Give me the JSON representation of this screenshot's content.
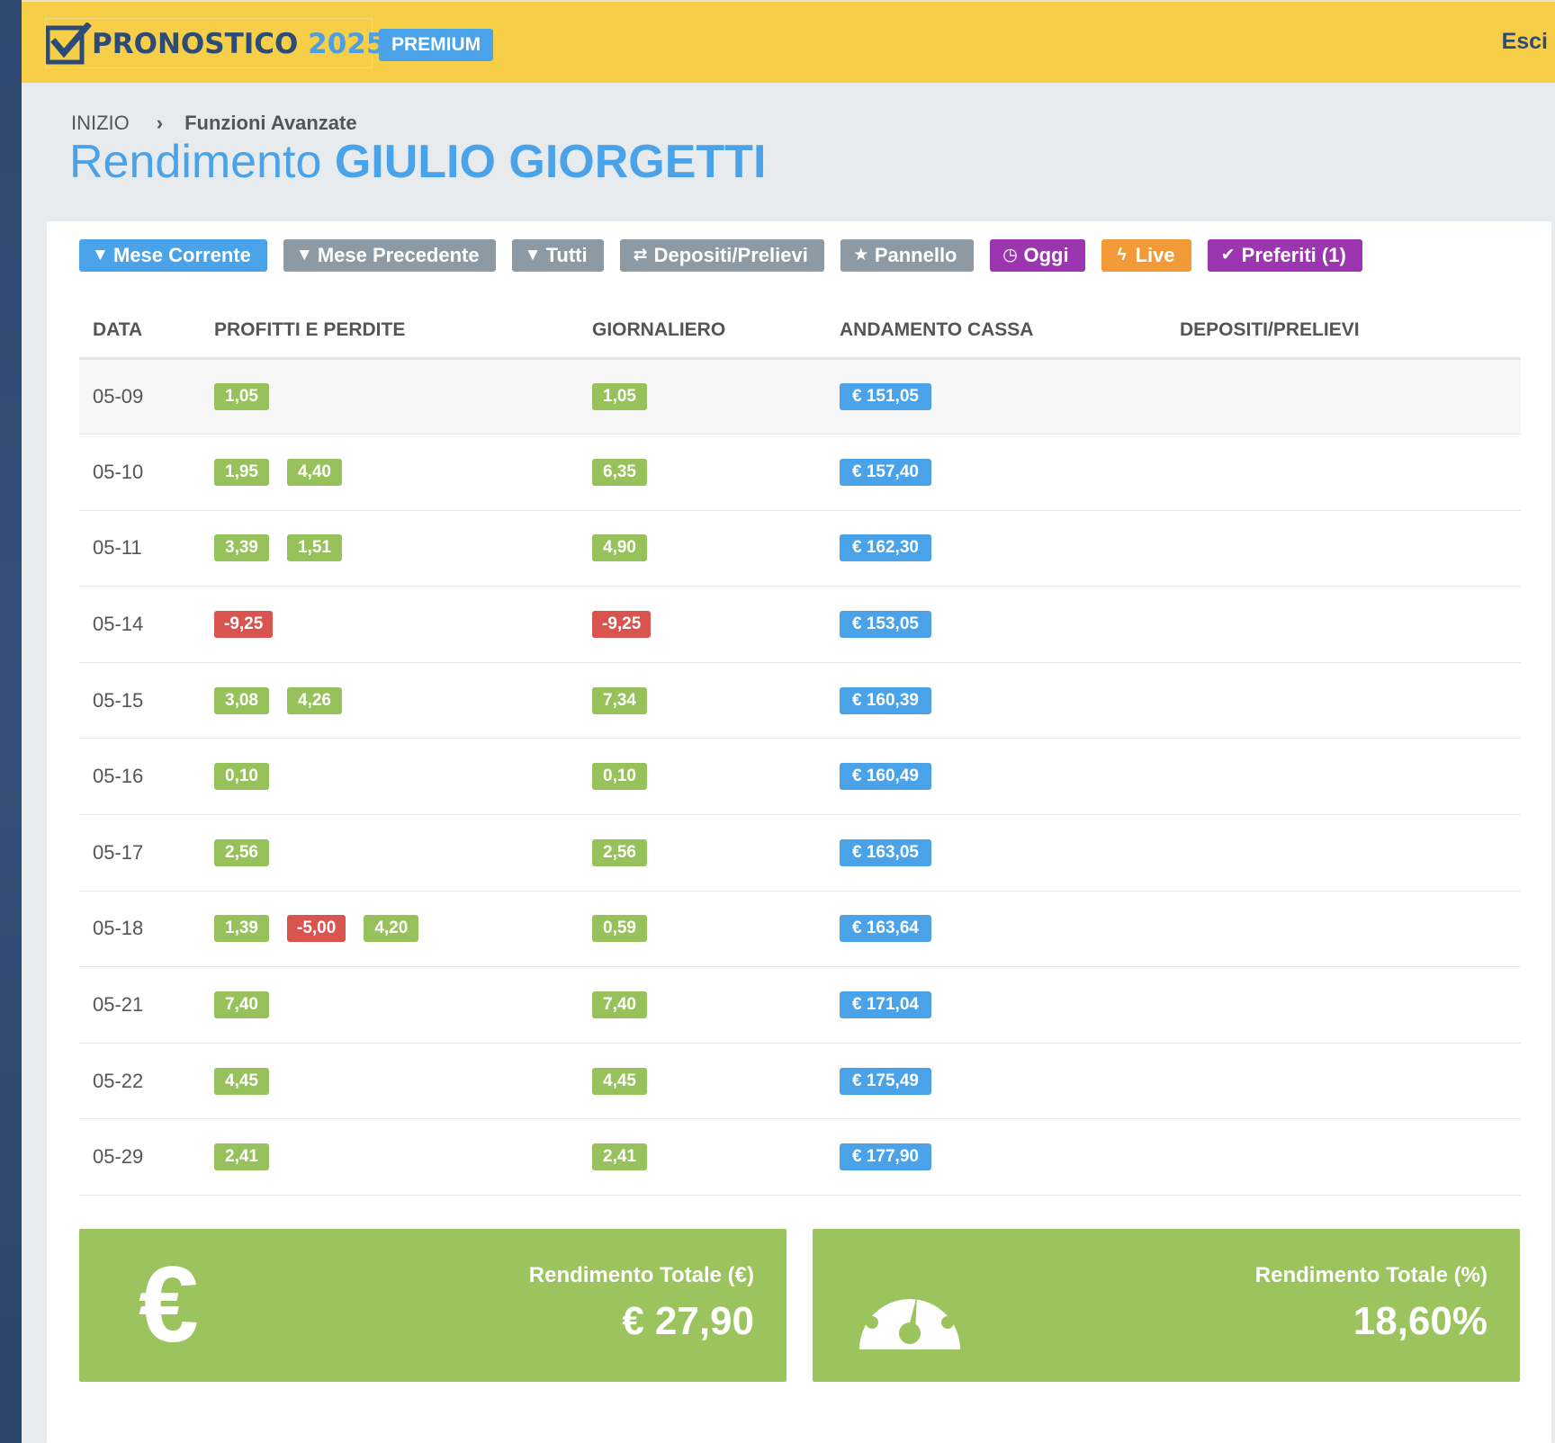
{
  "header": {
    "logo_part1": "PRONOSTICO",
    "logo_part2": "2025",
    "plan_badge": "PREMIUM",
    "logout": "Esci"
  },
  "breadcrumb": {
    "home": "INIZIO",
    "separator": "›",
    "current": "Funzioni Avanzate"
  },
  "page": {
    "title_prefix": "Rendimento",
    "title_name": "GIULIO GIORGETTI"
  },
  "filters": [
    {
      "label": "Mese Corrente",
      "icon": "filter-icon",
      "color": "#4aa3e8"
    },
    {
      "label": "Mese Precedente",
      "icon": "filter-icon",
      "color": "#8d9aa3"
    },
    {
      "label": "Tutti",
      "icon": "filter-icon",
      "color": "#8d9aa3"
    },
    {
      "label": "Depositi/Prelievi",
      "icon": "exchange-icon",
      "color": "#8d9aa3"
    },
    {
      "label": "Pannello",
      "icon": "star-icon",
      "color": "#8d9aa3"
    },
    {
      "label": "Oggi",
      "icon": "clock-icon",
      "color": "#9b35b0"
    },
    {
      "label": "Live",
      "icon": "bolt-icon",
      "color": "#f29a38"
    },
    {
      "label": "Preferiti (1)",
      "icon": "check-icon",
      "color": "#9b35b0"
    }
  ],
  "table": {
    "columns": [
      "DATA",
      "PROFITTI E PERDITE",
      "GIORNALIERO",
      "ANDAMENTO CASSA",
      "DEPOSITI/PRELIEVI"
    ],
    "rows": [
      {
        "date": "05-09",
        "pl": [
          "1,05"
        ],
        "daily": "1,05",
        "cash": "€ 151,05"
      },
      {
        "date": "05-10",
        "pl": [
          "1,95",
          "4,40"
        ],
        "daily": "6,35",
        "cash": "€ 157,40"
      },
      {
        "date": "05-11",
        "pl": [
          "3,39",
          "1,51"
        ],
        "daily": "4,90",
        "cash": "€ 162,30"
      },
      {
        "date": "05-14",
        "pl": [
          "-9,25"
        ],
        "daily": "-9,25",
        "cash": "€ 153,05"
      },
      {
        "date": "05-15",
        "pl": [
          "3,08",
          "4,26"
        ],
        "daily": "7,34",
        "cash": "€ 160,39"
      },
      {
        "date": "05-16",
        "pl": [
          "0,10"
        ],
        "daily": "0,10",
        "cash": "€ 160,49"
      },
      {
        "date": "05-17",
        "pl": [
          "2,56"
        ],
        "daily": "2,56",
        "cash": "€ 163,05"
      },
      {
        "date": "05-18",
        "pl": [
          "1,39",
          "-5,00",
          "4,20"
        ],
        "daily": "0,59",
        "cash": "€ 163,64"
      },
      {
        "date": "05-21",
        "pl": [
          "7,40"
        ],
        "daily": "7,40",
        "cash": "€ 171,04"
      },
      {
        "date": "05-22",
        "pl": [
          "4,45"
        ],
        "daily": "4,45",
        "cash": "€ 175,49"
      },
      {
        "date": "05-29",
        "pl": [
          "2,41"
        ],
        "daily": "2,41",
        "cash": "€ 177,90"
      }
    ]
  },
  "stats": {
    "total_eur_label": "Rendimento Totale (€)",
    "total_eur_value": "€ 27,90",
    "total_eur_icon": "euro-icon",
    "total_pct_label": "Rendimento Totale (%)",
    "total_pct_value": "18,60%",
    "total_pct_icon": "gauge-icon"
  },
  "colors": {
    "topbar": "#f6ce47",
    "accent_blue": "#4aa3e8",
    "positive": "#96c15b",
    "negative": "#d9534f",
    "stat_card": "#9bc45e"
  }
}
